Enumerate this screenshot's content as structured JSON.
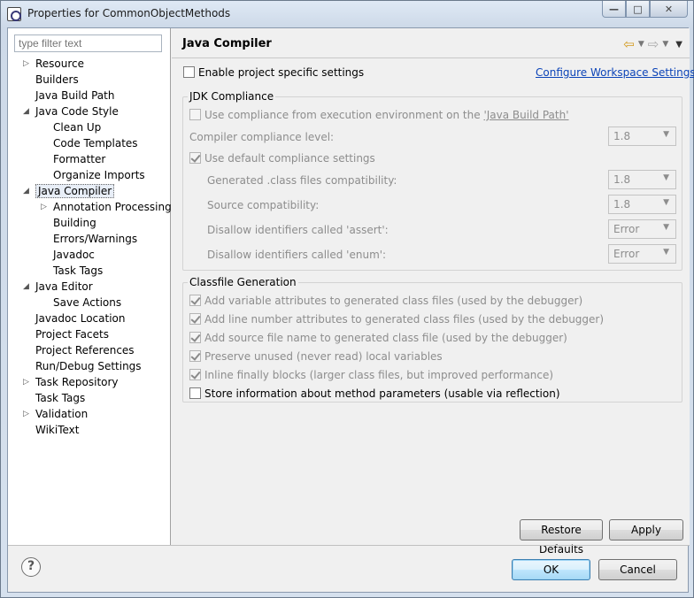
{
  "window": {
    "title": "Properties for CommonObjectMethods",
    "minimize_label": "—",
    "maximize_label": "□",
    "close_label": "✕"
  },
  "sidebar": {
    "filter_placeholder": "type filter text",
    "items": [
      {
        "label": "Resource",
        "twisty": "▷",
        "level": 0
      },
      {
        "label": "Builders",
        "twisty": "",
        "level": 0
      },
      {
        "label": "Java Build Path",
        "twisty": "",
        "level": 0
      },
      {
        "label": "Java Code Style",
        "twisty": "◢",
        "level": 0
      },
      {
        "label": "Clean Up",
        "twisty": "",
        "level": 1
      },
      {
        "label": "Code Templates",
        "twisty": "",
        "level": 1
      },
      {
        "label": "Formatter",
        "twisty": "",
        "level": 1
      },
      {
        "label": "Organize Imports",
        "twisty": "",
        "level": 1
      },
      {
        "label": "Java Compiler",
        "twisty": "◢",
        "level": 0,
        "selected": true
      },
      {
        "label": "Annotation Processing",
        "twisty": "▷",
        "level": 1
      },
      {
        "label": "Building",
        "twisty": "",
        "level": 1
      },
      {
        "label": "Errors/Warnings",
        "twisty": "",
        "level": 1
      },
      {
        "label": "Javadoc",
        "twisty": "",
        "level": 1
      },
      {
        "label": "Task Tags",
        "twisty": "",
        "level": 1
      },
      {
        "label": "Java Editor",
        "twisty": "◢",
        "level": 0
      },
      {
        "label": "Save Actions",
        "twisty": "",
        "level": 1
      },
      {
        "label": "Javadoc Location",
        "twisty": "",
        "level": 0
      },
      {
        "label": "Project Facets",
        "twisty": "",
        "level": 0
      },
      {
        "label": "Project References",
        "twisty": "",
        "level": 0
      },
      {
        "label": "Run/Debug Settings",
        "twisty": "",
        "level": 0
      },
      {
        "label": "Task Repository",
        "twisty": "▷",
        "level": 0
      },
      {
        "label": "Task Tags",
        "twisty": "",
        "level": 0
      },
      {
        "label": "Validation",
        "twisty": "▷",
        "level": 0
      },
      {
        "label": "WikiText",
        "twisty": "",
        "level": 0
      }
    ]
  },
  "page": {
    "title": "Java Compiler",
    "enable_specific": {
      "label": "Enable project specific settings",
      "checked": false
    },
    "configure_link": "Configure Workspace Settings...",
    "jdk": {
      "group_title": "JDK Compliance",
      "use_env_prefix": "Use compliance from execution environment on the ",
      "use_env_link": "'Java Build Path'",
      "compliance_level_label": "Compiler compliance level:",
      "compliance_level_value": "1.8",
      "use_default_label": "Use default compliance settings",
      "class_compat_label": "Generated .class files compatibility:",
      "class_compat_value": "1.8",
      "source_compat_label": "Source compatibility:",
      "source_compat_value": "1.8",
      "assert_label": "Disallow identifiers called 'assert':",
      "assert_value": "Error",
      "enum_label": "Disallow identifiers called 'enum':",
      "enum_value": "Error"
    },
    "classfile": {
      "group_title": "Classfile Generation",
      "options": [
        {
          "label": "Add variable attributes to generated class files (used by the debugger)",
          "checked": true,
          "enabled": false
        },
        {
          "label": "Add line number attributes to generated class files (used by the debugger)",
          "checked": true,
          "enabled": false
        },
        {
          "label": "Add source file name to generated class file (used by the debugger)",
          "checked": true,
          "enabled": false
        },
        {
          "label": "Preserve unused (never read) local variables",
          "checked": true,
          "enabled": false
        },
        {
          "label": "Inline finally blocks (larger class files, but improved performance)",
          "checked": true,
          "enabled": false
        },
        {
          "label": "Store information about method parameters (usable via reflection)",
          "checked": false,
          "enabled": true
        }
      ]
    },
    "restore_defaults_label": "Restore Defaults",
    "apply_label": "Apply"
  },
  "footer": {
    "help_label": "?",
    "ok_label": "OK",
    "cancel_label": "Cancel"
  }
}
